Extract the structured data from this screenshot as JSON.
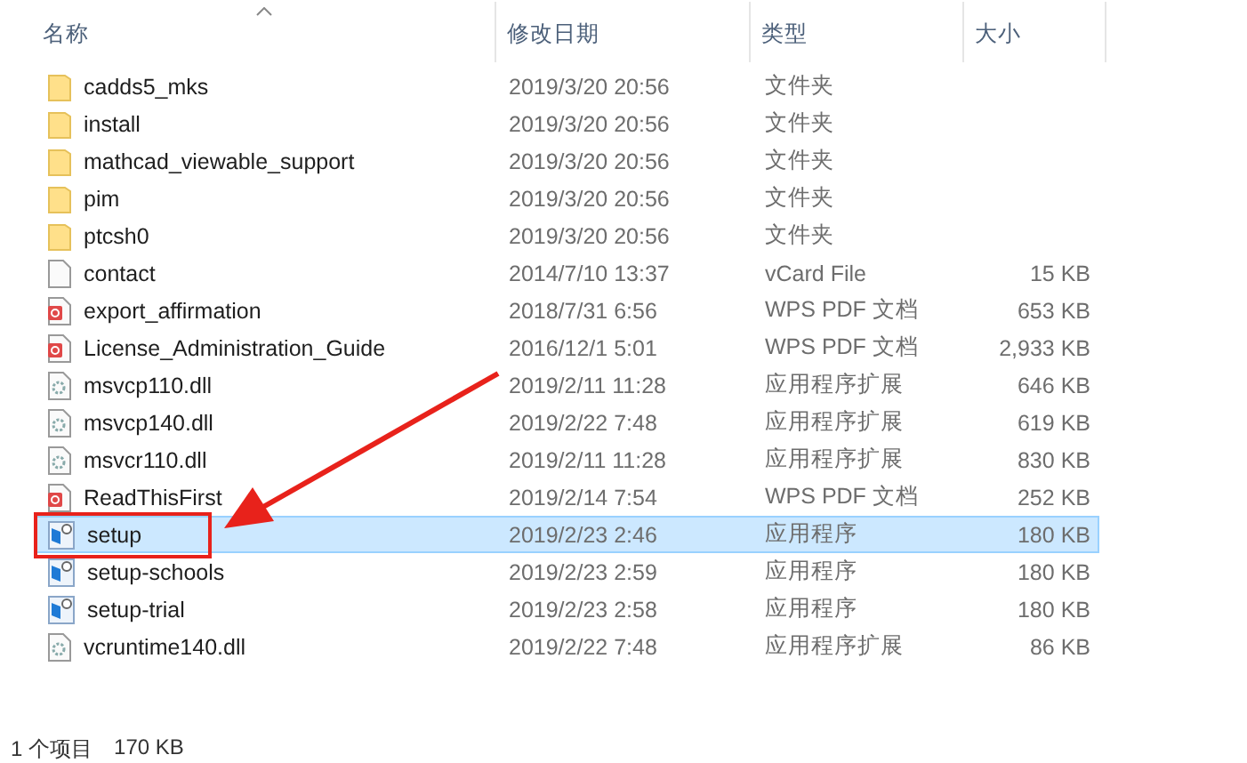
{
  "columns": [
    {
      "label": "名称",
      "sorted": true
    },
    {
      "label": "修改日期",
      "sorted": false
    },
    {
      "label": "类型",
      "sorted": false
    },
    {
      "label": "大小",
      "sorted": false
    }
  ],
  "files": [
    {
      "kind": "folder",
      "name": "cadds5_mks",
      "modified": "2019/3/20 20:56",
      "type": "文件夹",
      "selected": false
    },
    {
      "kind": "folder",
      "name": "install",
      "modified": "2019/3/20 20:56",
      "type": "文件夹",
      "selected": false
    },
    {
      "kind": "folder",
      "name": "mathcad_viewable_support",
      "modified": "2019/3/20 20:56",
      "type": "文件夹",
      "selected": false
    },
    {
      "kind": "folder",
      "name": "pim",
      "modified": "2019/3/20 20:56",
      "type": "文件夹",
      "selected": false
    },
    {
      "kind": "folder",
      "name": "ptcsh0",
      "modified": "2019/3/20 20:56",
      "type": "文件夹",
      "selected": false
    },
    {
      "kind": "vcard",
      "name": "contact",
      "modified": "2014/7/10 13:37",
      "type": "vCard File",
      "size": "15 KB",
      "selected": false
    },
    {
      "kind": "pdf",
      "name": "export_affirmation",
      "modified": "2018/7/31 6:56",
      "type": "WPS PDF 文档",
      "size": "653 KB",
      "selected": false
    },
    {
      "kind": "pdf",
      "name": "License_Administration_Guide",
      "modified": "2016/12/1 5:01",
      "type": "WPS PDF 文档",
      "size": "2,933 KB",
      "selected": false
    },
    {
      "kind": "dll",
      "name": "msvcp110.dll",
      "modified": "2019/2/11 11:28",
      "type": "应用程序扩展",
      "size": "646 KB",
      "selected": false
    },
    {
      "kind": "dll",
      "name": "msvcp140.dll",
      "modified": "2019/2/22 7:48",
      "type": "应用程序扩展",
      "size": "619 KB",
      "selected": false
    },
    {
      "kind": "dll",
      "name": "msvcr110.dll",
      "modified": "2019/2/11 11:28",
      "type": "应用程序扩展",
      "size": "830 KB",
      "selected": false
    },
    {
      "kind": "pdf",
      "name": "ReadThisFirst",
      "modified": "2019/2/14 7:54",
      "type": "WPS PDF 文档",
      "size": "252 KB",
      "selected": false
    },
    {
      "kind": "exe",
      "name": "setup",
      "modified": "2019/2/23 2:46",
      "type": "应用程序",
      "size": "180 KB",
      "selected": true
    },
    {
      "kind": "exe",
      "name": "setup-schools",
      "modified": "2019/2/23 2:59",
      "type": "应用程序",
      "size": "180 KB",
      "selected": false
    },
    {
      "kind": "exe",
      "name": "setup-trial",
      "modified": "2019/2/23 2:58",
      "type": "应用程序",
      "size": "180 KB",
      "selected": false
    },
    {
      "kind": "dll",
      "name": "vcruntime140.dll",
      "modified": "2019/2/22 7:48",
      "type": "应用程序扩展",
      "size": "86 KB",
      "selected": false
    }
  ],
  "status_bar": {
    "count": "1 个项目",
    "size": "170 KB"
  }
}
